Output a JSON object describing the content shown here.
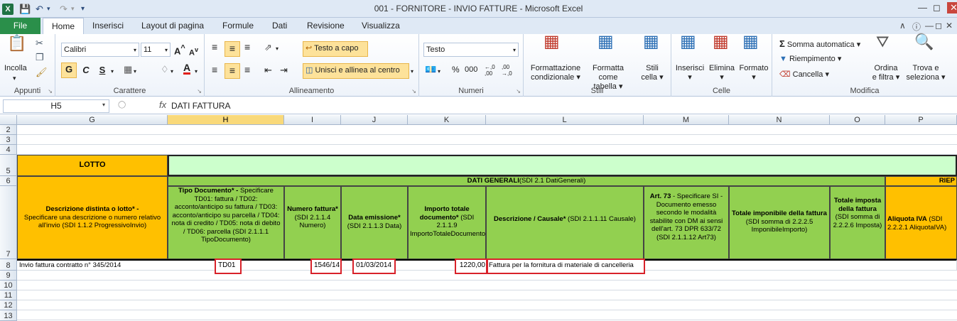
{
  "window": {
    "title": "001 - FORNITORE - INVIO FATTURE  -  Microsoft Excel"
  },
  "tabs": {
    "file": "File",
    "home": "Home",
    "inserisci": "Inserisci",
    "layout": "Layout di pagina",
    "formule": "Formule",
    "dati": "Dati",
    "revisione": "Revisione",
    "visualizza": "Visualizza"
  },
  "ribbon": {
    "appunti": {
      "label": "Appunti",
      "incolla": "Incolla"
    },
    "carattere": {
      "label": "Carattere",
      "font": "Calibri",
      "size": "11",
      "bold": "G",
      "italic": "C",
      "underline": "S"
    },
    "allineamento": {
      "label": "Allineamento",
      "testo_a_capo": "Testo a capo",
      "unisci": "Unisci e allinea al centro"
    },
    "numeri": {
      "label": "Numeri",
      "format": "Testo"
    },
    "stili": {
      "label": "Stili",
      "formattazione": "Formattazione",
      "condizionale": "condizionale",
      "formatta": "Formatta",
      "come_tabella": "come tabella",
      "stili": "Stili",
      "cella": "cella"
    },
    "celle": {
      "label": "Celle",
      "inserisci": "Inserisci",
      "elimina": "Elimina",
      "formato": "Formato"
    },
    "modifica": {
      "label": "Modifica",
      "somma": "Somma automatica",
      "riempimento": "Riempimento",
      "cancella": "Cancella",
      "ordina": "Ordina",
      "e_filtra": "e filtra",
      "trova": "Trova e",
      "seleziona": "seleziona"
    }
  },
  "formula_bar": {
    "name_box": "H5",
    "content": "DATI FATTURA"
  },
  "columns": [
    "G",
    "H",
    "I",
    "J",
    "K",
    "L",
    "M",
    "N",
    "O",
    "P"
  ],
  "rows": [
    "2",
    "3",
    "4",
    "5",
    "6",
    "7",
    "8",
    "9",
    "10",
    "11",
    "12",
    "13"
  ],
  "sheet": {
    "lotto": "LOTTO",
    "dati_generali": "DATI GENERALI",
    "dati_generali_ref": " (SDI 2.1 DatiGenerali)",
    "riep": "RIEP",
    "h7": {
      "g": {
        "b": "Descrizione distinta o lotto* - ",
        "n": "Specificare una descrizione o numero relativo all'invio (SDI 1.1.2 ProgressivoInvio)"
      },
      "h": {
        "b": "Tipo Documento* - ",
        "n": "Specificare TD01: fattura / TD02: acconto/anticipo su fattura / TD03: acconto/anticipo su parcella / TD04: nota di credito / TD05: nota di debito / TD06: parcella (SDI 2.1.1.1 TipoDocumento)"
      },
      "i": {
        "b": "Numero fattura*",
        "n": " (SDI 2.1.1.4 Numero)"
      },
      "j": {
        "b": "Data emissione*",
        "n": " (SDI 2.1.1.3 Data)"
      },
      "k": {
        "b": "Importo totale documento*",
        "n": " (SDI 2.1.1.9 ImportoTotaleDocumento)"
      },
      "l": {
        "b": "Descrizione / Causale*",
        "n": " (SDI 2.1.1.11 Causale)"
      },
      "m": {
        "b": "Art. 73",
        "n": " - Specificare SI - Documento emesso secondo le modalità stabilite con DM ai sensi dell'art. 73 DPR 633/72 (SDI 2.1.1.12 Art73)"
      },
      "n": {
        "b": "Totale imponibile della fattura",
        "n": " (SDI somma di 2.2.2.5 ImponibileImporto)"
      },
      "o": {
        "b": "Totale imposta della fattura",
        "n": " (SDI somma di 2.2.2.6 Imposta)"
      },
      "p": {
        "b": "Aliquota IVA",
        "n": " (SDI 2.2.2.1 AliquotaIVA)"
      }
    },
    "r8": {
      "g": "Invio fattura contratto n° 345/2014",
      "h": "TD01",
      "i": "1546/14",
      "j": "01/03/2014",
      "k": "1220,00",
      "l": "Fattura per la fornitura di materiale di cancelleria"
    }
  },
  "colors": {
    "green": "#92d050",
    "orange": "#ffc000",
    "light_green": "#ccffcc",
    "red": "#d8222a",
    "file_tab": "#2a8f4a"
  }
}
